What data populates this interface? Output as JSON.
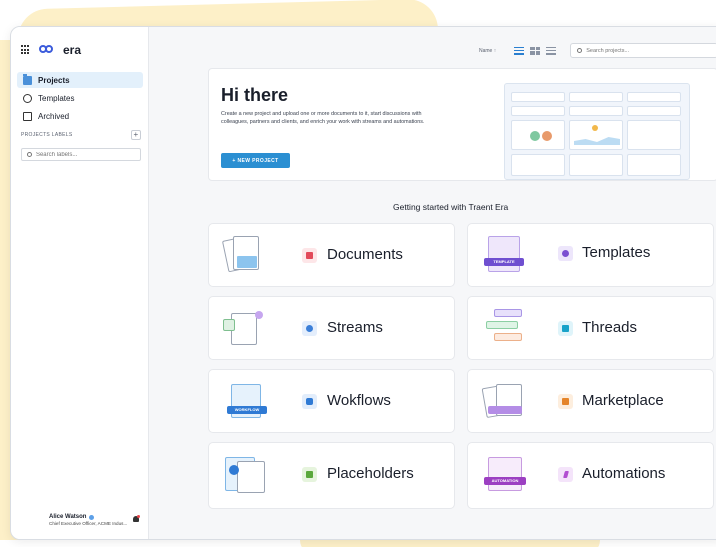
{
  "app": {
    "brand": "era"
  },
  "sidebar": {
    "items": [
      {
        "label": "Projects",
        "icon": "folder-icon",
        "active": true
      },
      {
        "label": "Templates",
        "icon": "templates-icon",
        "active": false
      },
      {
        "label": "Archived",
        "icon": "archive-icon",
        "active": false
      }
    ],
    "labels_header": "PROJECTS LABELS",
    "labels_add": "+",
    "labels_search_placeholder": "Search labels..."
  },
  "user": {
    "name": "Alice Watson",
    "role": "Chief Executive Officer, ACME Indus..."
  },
  "toolbar": {
    "sort_label": "Name ↑",
    "search_placeholder": "Search projects..."
  },
  "hero": {
    "title": "Hi there",
    "description": "Create a new project and upload one or more documents to it, start discussions with colleagues, partners and clients, and enrich your work with streams and automations.",
    "button_label": "+ NEW PROJECT"
  },
  "getting_started": {
    "title": "Getting started with Traent Era",
    "cards": [
      {
        "label": "Documents",
        "icon": "document-icon",
        "color": "#e24a5a",
        "bg": "#fde6e8"
      },
      {
        "label": "Templates",
        "icon": "templates-icon",
        "color": "#7b4fd1",
        "bg": "#ede6fb"
      },
      {
        "label": "Streams",
        "icon": "streams-icon",
        "color": "#3b7fd8",
        "bg": "#e4eefc"
      },
      {
        "label": "Threads",
        "icon": "threads-icon",
        "color": "#1aa3c9",
        "bg": "#dff4fa"
      },
      {
        "label": "Wokflows",
        "icon": "workflows-icon",
        "color": "#2f7ad4",
        "bg": "#e2edfb"
      },
      {
        "label": "Marketplace",
        "icon": "marketplace-icon",
        "color": "#e5852b",
        "bg": "#fdeede"
      },
      {
        "label": "Placeholders",
        "icon": "placeholders-icon",
        "color": "#5aa83b",
        "bg": "#e6f4dd"
      },
      {
        "label": "Automations",
        "icon": "automations-icon",
        "color": "#b24fd1",
        "bg": "#f4e4fa"
      }
    ],
    "thumb_tags": {
      "templates": "TEMPLATE",
      "wokflows": "WORKFLOW",
      "automations": "AUTOMATION"
    }
  }
}
